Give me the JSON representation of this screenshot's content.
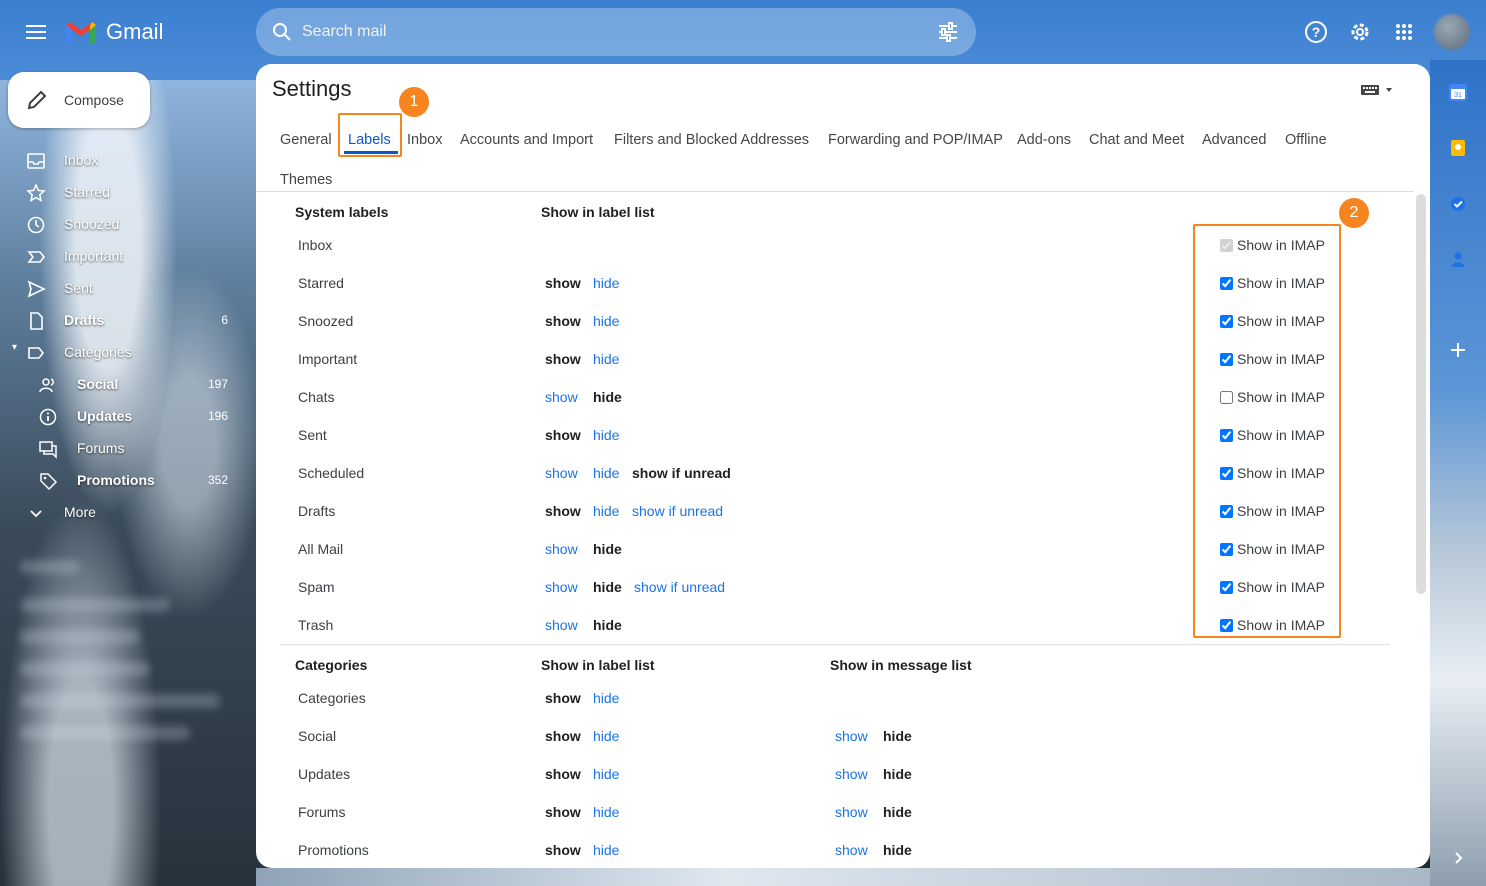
{
  "app": {
    "name": "Gmail",
    "brand_colors": {
      "red": "#ea4335",
      "blue": "#4285f4",
      "yellow": "#fbbc04",
      "green": "#34a853"
    },
    "accent": "#0b57d0",
    "link_color": "#1a73e8",
    "annotation_color": "#f6851f"
  },
  "search": {
    "placeholder": "Search mail",
    "icon": "search-icon",
    "options_icon": "tune-icon"
  },
  "header_icons": [
    "help-icon",
    "settings-gear-icon",
    "apps-grid-icon",
    "account-avatar"
  ],
  "compose": {
    "label": "Compose",
    "icon": "pencil-icon"
  },
  "sidebar": {
    "items": [
      {
        "label": "Inbox",
        "icon": "inbox-icon",
        "count": "",
        "bold": false
      },
      {
        "label": "Starred",
        "icon": "star-icon",
        "count": "",
        "bold": false
      },
      {
        "label": "Snoozed",
        "icon": "clock-icon",
        "count": "",
        "bold": false
      },
      {
        "label": "Important",
        "icon": "important-icon",
        "count": "",
        "bold": false
      },
      {
        "label": "Sent",
        "icon": "send-icon",
        "count": "",
        "bold": false
      },
      {
        "label": "Drafts",
        "icon": "draft-icon",
        "count": "6",
        "bold": true
      },
      {
        "label": "Categories",
        "icon": "label-icon",
        "count": "",
        "bold": false
      }
    ],
    "categories": [
      {
        "label": "Social",
        "icon": "people-icon",
        "count": "197",
        "bold": true
      },
      {
        "label": "Updates",
        "icon": "info-icon",
        "count": "196",
        "bold": true
      },
      {
        "label": "Forums",
        "icon": "forum-icon",
        "count": "",
        "bold": false
      },
      {
        "label": "Promotions",
        "icon": "tag-icon",
        "count": "352",
        "bold": true
      }
    ],
    "more": "More"
  },
  "settings": {
    "title": "Settings",
    "tabs": [
      "General",
      "Labels",
      "Inbox",
      "Accounts and Import",
      "Filters and Blocked Addresses",
      "Forwarding and POP/IMAP",
      "Add-ons",
      "Chat and Meet",
      "Advanced",
      "Offline",
      "Themes"
    ],
    "active_tab": "Labels",
    "system_labels": {
      "header_name": "System labels",
      "header_show": "Show in label list",
      "rows": [
        {
          "name": "Inbox",
          "options": [],
          "imap": "Show in IMAP",
          "imap_checked": true,
          "imap_disabled": true
        },
        {
          "name": "Starred",
          "options": [
            {
              "text": "show",
              "selected": true
            },
            {
              "text": "hide",
              "selected": false
            }
          ],
          "imap": "Show in IMAP",
          "imap_checked": true,
          "imap_disabled": false
        },
        {
          "name": "Snoozed",
          "options": [
            {
              "text": "show",
              "selected": true
            },
            {
              "text": "hide",
              "selected": false
            }
          ],
          "imap": "Show in IMAP",
          "imap_checked": true,
          "imap_disabled": false
        },
        {
          "name": "Important",
          "options": [
            {
              "text": "show",
              "selected": true
            },
            {
              "text": "hide",
              "selected": false
            }
          ],
          "imap": "Show in IMAP",
          "imap_checked": true,
          "imap_disabled": false
        },
        {
          "name": "Chats",
          "options": [
            {
              "text": "show",
              "selected": false
            },
            {
              "text": "hide",
              "selected": true
            }
          ],
          "imap": "Show in IMAP",
          "imap_checked": false,
          "imap_disabled": false
        },
        {
          "name": "Sent",
          "options": [
            {
              "text": "show",
              "selected": true
            },
            {
              "text": "hide",
              "selected": false
            }
          ],
          "imap": "Show in IMAP",
          "imap_checked": true,
          "imap_disabled": false
        },
        {
          "name": "Scheduled",
          "options": [
            {
              "text": "show",
              "selected": false
            },
            {
              "text": "hide",
              "selected": false
            },
            {
              "text": "show if unread",
              "selected": true
            }
          ],
          "imap": "Show in IMAP",
          "imap_checked": true,
          "imap_disabled": false
        },
        {
          "name": "Drafts",
          "options": [
            {
              "text": "show",
              "selected": true
            },
            {
              "text": "hide",
              "selected": false
            },
            {
              "text": "show if unread",
              "selected": false
            }
          ],
          "imap": "Show in IMAP",
          "imap_checked": true,
          "imap_disabled": false
        },
        {
          "name": "All Mail",
          "options": [
            {
              "text": "show",
              "selected": false
            },
            {
              "text": "hide",
              "selected": true
            }
          ],
          "imap": "Show in IMAP",
          "imap_checked": true,
          "imap_disabled": false
        },
        {
          "name": "Spam",
          "options": [
            {
              "text": "show",
              "selected": false
            },
            {
              "text": "hide",
              "selected": true
            },
            {
              "text": "show if unread",
              "selected": false
            }
          ],
          "imap": "Show in IMAP",
          "imap_checked": true,
          "imap_disabled": false
        },
        {
          "name": "Trash",
          "options": [
            {
              "text": "show",
              "selected": false
            },
            {
              "text": "hide",
              "selected": true
            }
          ],
          "imap": "Show in IMAP",
          "imap_checked": true,
          "imap_disabled": false
        }
      ]
    },
    "categories": {
      "header_name": "Categories",
      "header_show": "Show in label list",
      "header_msg": "Show in message list",
      "rows": [
        {
          "name": "Categories",
          "label_options": [
            {
              "text": "show",
              "selected": true
            },
            {
              "text": "hide",
              "selected": false
            }
          ],
          "msg_options": []
        },
        {
          "name": "Social",
          "label_options": [
            {
              "text": "show",
              "selected": true
            },
            {
              "text": "hide",
              "selected": false
            }
          ],
          "msg_options": [
            {
              "text": "show",
              "selected": false
            },
            {
              "text": "hide",
              "selected": true
            }
          ]
        },
        {
          "name": "Updates",
          "label_options": [
            {
              "text": "show",
              "selected": true
            },
            {
              "text": "hide",
              "selected": false
            }
          ],
          "msg_options": [
            {
              "text": "show",
              "selected": false
            },
            {
              "text": "hide",
              "selected": true
            }
          ]
        },
        {
          "name": "Forums",
          "label_options": [
            {
              "text": "show",
              "selected": true
            },
            {
              "text": "hide",
              "selected": false
            }
          ],
          "msg_options": [
            {
              "text": "show",
              "selected": false
            },
            {
              "text": "hide",
              "selected": true
            }
          ]
        },
        {
          "name": "Promotions",
          "label_options": [
            {
              "text": "show",
              "selected": true
            },
            {
              "text": "hide",
              "selected": false
            }
          ],
          "msg_options": [
            {
              "text": "show",
              "selected": false
            },
            {
              "text": "hide",
              "selected": true
            }
          ]
        }
      ]
    }
  },
  "annotations": [
    {
      "number": "1"
    },
    {
      "number": "2"
    }
  ],
  "side_panel_icons": [
    "calendar-icon",
    "keep-icon",
    "tasks-icon",
    "contacts-icon",
    "add-icon"
  ]
}
